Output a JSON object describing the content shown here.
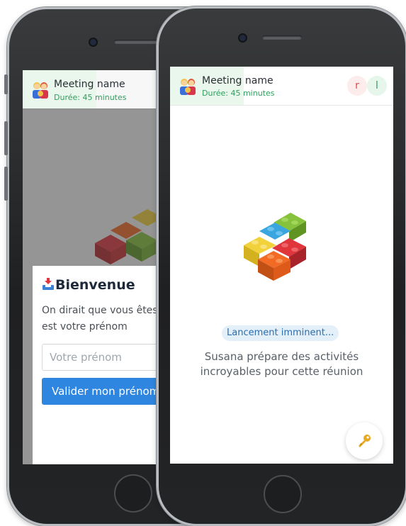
{
  "back_phone": {
    "header": {
      "meeting_name": "Meeting name",
      "duration": "Durée: 45 minutes",
      "icon": "family-icon"
    },
    "modal": {
      "title": "Bienvenue",
      "title_icon": "inbox-tray-icon",
      "text_line1": "On dirait que vous êtes",
      "text_line2": "est votre prénom",
      "input_placeholder": "Votre prénom",
      "button_label": "Valider mon prénom"
    }
  },
  "front_phone": {
    "header": {
      "meeting_name": "Meeting name",
      "duration": "Durée: 45 minutes",
      "icon": "family-icon",
      "participants": [
        {
          "initial": "r",
          "color": "#e0474c",
          "bg": "#fdecec"
        },
        {
          "initial": "l",
          "color": "#2f9e5d",
          "bg": "#e6f6ea"
        }
      ]
    },
    "status_badge": "Lancement imminent...",
    "message_line1": "Susana prépare des activités",
    "message_line2": "incroyables pour cette réunion",
    "key_button_icon": "key-icon"
  },
  "colors": {
    "accent_blue": "#2f86e0",
    "accent_green": "#2f9e5d",
    "brick_red": "#e0353b",
    "brick_yellow": "#f2d23a",
    "brick_blue": "#3aa6e0",
    "brick_green": "#86c23b",
    "brick_orange": "#f26a24"
  }
}
